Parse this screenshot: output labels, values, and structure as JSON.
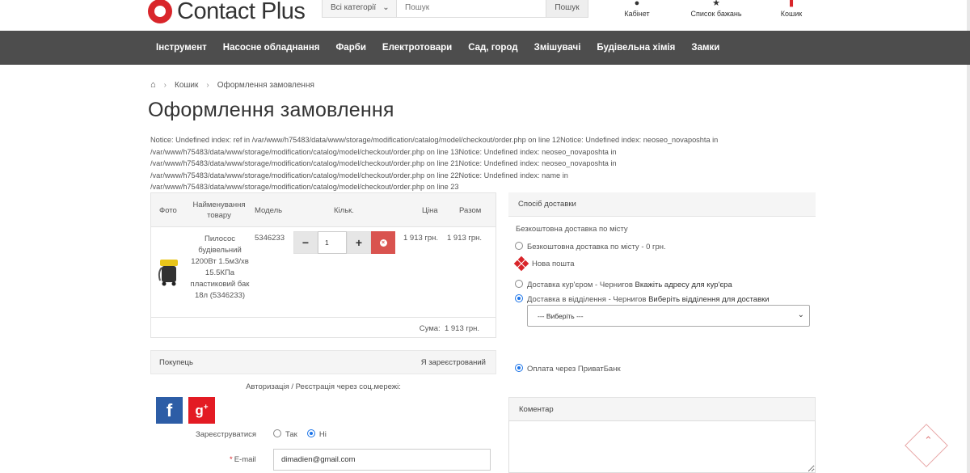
{
  "header": {
    "logo_text": "Contact Plus",
    "category_select": "Всі категорії",
    "search_placeholder": "Пошук",
    "search_button": "Пошук",
    "cabinet": "Кабінет",
    "wishlist": "Список бажань",
    "cart": "Кошик"
  },
  "nav": {
    "items": [
      "Інструмент",
      "Насосне обладнання",
      "Фарби",
      "Електротовари",
      "Сад, город",
      "Змішувачі",
      "Будівельна хімія",
      "Замки"
    ]
  },
  "breadcrumb": {
    "items": [
      "Кошик",
      "Оформлення замовлення"
    ]
  },
  "page_title": "Оформлення замовлення",
  "notice_lines": [
    "Notice: Undefined index: ref in /var/www/h75483/data/www/storage/modification/catalog/model/checkout/order.php on line 12Notice: Undefined index: neoseo_novaposhta in",
    "/var/www/h75483/data/www/storage/modification/catalog/model/checkout/order.php on line 13Notice: Undefined index: neoseo_novaposhta in",
    "/var/www/h75483/data/www/storage/modification/catalog/model/checkout/order.php on line 21Notice: Undefined index: neoseo_novaposhta in",
    "/var/www/h75483/data/www/storage/modification/catalog/model/checkout/order.php on line 22Notice: Undefined index: name in",
    "/var/www/h75483/data/www/storage/modification/catalog/model/checkout/order.php on line 23"
  ],
  "cart": {
    "headers": {
      "photo": "Фото",
      "name": "Найменування товару",
      "model": "Модель",
      "qty": "Кільк.",
      "price": "Ціна",
      "total": "Разом"
    },
    "product": {
      "name": "Пилосос будівельний 1200Вт 1.5м3/хв 15.5КПа пластиковий бак 18л (5346233)",
      "model": "5346233",
      "qty": "1",
      "price": "1 913 грн.",
      "total": "1 913 грн."
    },
    "sum_label": "Сума:",
    "sum_value": "1 913 грн."
  },
  "buyer": {
    "title": "Покупець",
    "registered": "Я зареєстрований",
    "social_title": "Авторизація / Реєстрація через соц.мережі:",
    "facebook": "f",
    "google": "g",
    "google_sup": "+",
    "register_label": "Зареєструватися",
    "register_yes": "Так",
    "register_no": "Ні",
    "email_label": "E-mail",
    "email_value": "dimadien@gmail.com"
  },
  "delivery": {
    "title": "Спосіб доставки",
    "free_title": "Безкоштовна доставка по місту",
    "free_option": "Безкоштовна доставка по місту - 0 грн.",
    "novaposhta": "Нова пошта",
    "courier": "Доставка кур'єром - Чернигов",
    "courier_hint": "Вкажіть адресу для кур'єра",
    "branch": "Доставка в відділення - Чернигов",
    "branch_hint": "Виберіть відділення для доставки",
    "branch_select": "--- Виберіть ---"
  },
  "payment": {
    "option": "Оплата через ПриватБанк"
  },
  "comment": {
    "title": "Коментар"
  }
}
